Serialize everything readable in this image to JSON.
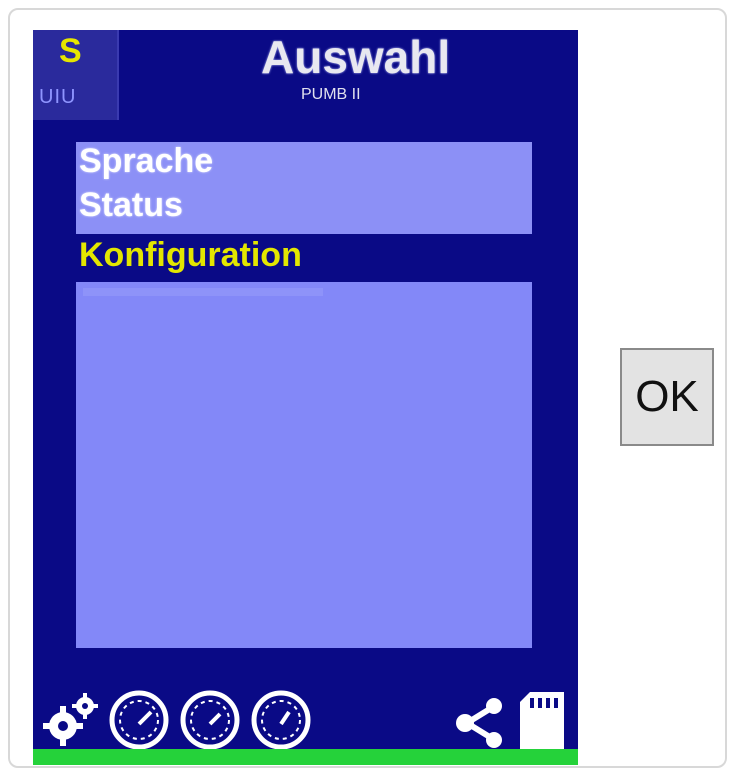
{
  "device": {
    "header": {
      "badge_letter": "S",
      "badge_sub": "UIU",
      "title": "Auswahl",
      "subtitle": "PUMB II"
    },
    "menu": {
      "items": [
        {
          "label": "Sprache",
          "selected": false
        },
        {
          "label": "Status",
          "selected": false
        },
        {
          "label": "Konfiguration",
          "selected": true
        }
      ]
    },
    "footer": {
      "icons": [
        "settings-gears-icon",
        "gauge-icon",
        "gauge-icon",
        "gauge-icon",
        "share-icon",
        "sd-card-icon"
      ]
    },
    "colors": {
      "background": "#0a0a86",
      "panel": "#8388f8",
      "selected_text": "#e3e600",
      "status_bar": "#25d23a"
    }
  },
  "controls": {
    "ok_label": "OK"
  }
}
